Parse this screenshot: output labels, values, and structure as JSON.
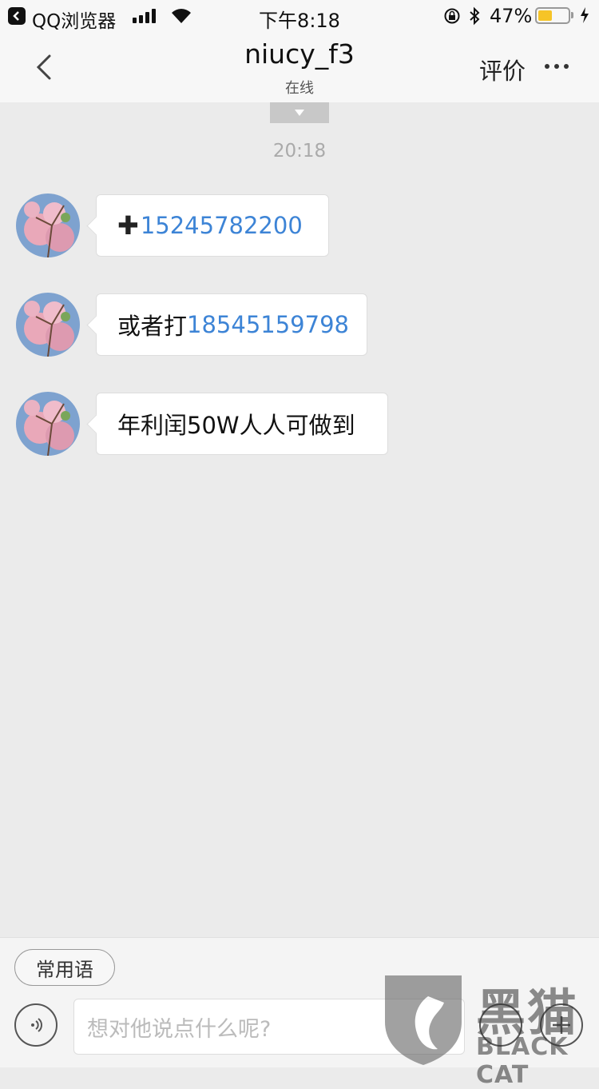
{
  "status_bar": {
    "back_app": "QQ浏览器",
    "time": "下午8:18",
    "battery_percent": "47%",
    "battery_level": 0.47,
    "icons": [
      "back-app-icon",
      "signal-icon",
      "wifi-icon",
      "orientation-lock-icon",
      "bluetooth-icon",
      "battery-icon",
      "charging-icon"
    ]
  },
  "nav": {
    "title": "niucy_f3",
    "status": "在线",
    "rate_label": "评价"
  },
  "chat": {
    "timestamp": "20:18",
    "messages": [
      {
        "prefix_icon": "plus",
        "prefix": "",
        "link": "15245782200",
        "suffix": ""
      },
      {
        "prefix": "或者打",
        "link": "18545159798",
        "suffix": ""
      },
      {
        "prefix": "年利闰50W人人可做到",
        "link": "",
        "suffix": ""
      }
    ]
  },
  "input_bar": {
    "phrases_label": "常用语",
    "placeholder": "想对他说点什么呢?"
  },
  "watermark": {
    "cn": "黑猫",
    "en": "BLACK CAT"
  },
  "colors": {
    "background": "#ebebeb",
    "link": "#3d84d6",
    "battery": "#f6c427"
  }
}
